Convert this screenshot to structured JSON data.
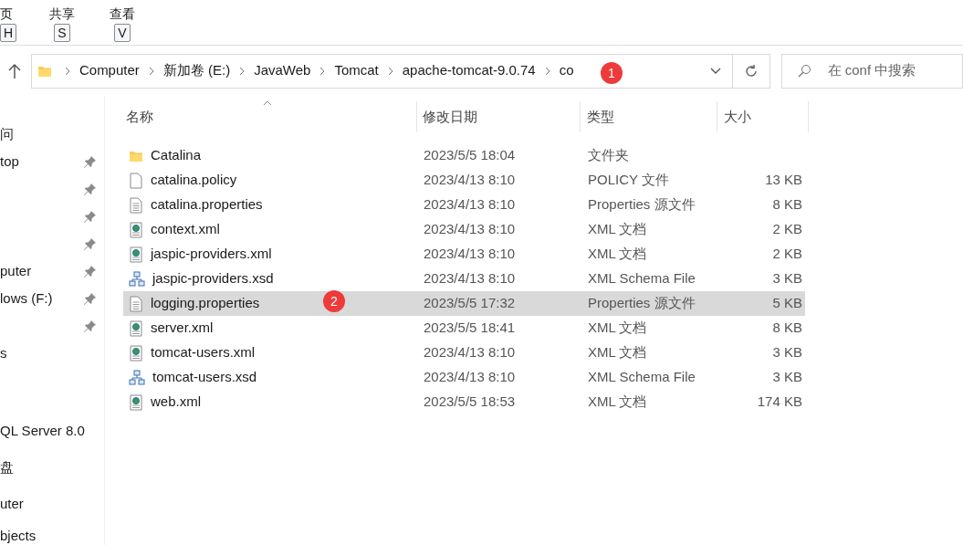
{
  "ribbon": {
    "tabs": [
      {
        "label": "页",
        "key": "H"
      },
      {
        "label": "共享",
        "key": "S"
      },
      {
        "label": "查看",
        "key": "V"
      }
    ]
  },
  "address_bar": {
    "path": [
      "Computer",
      "新加卷 (E:)",
      "JavaWeb",
      "Tomcat",
      "apache-tomcat-9.0.74",
      "co"
    ]
  },
  "search": {
    "placeholder": "在 conf 中搜索"
  },
  "sidebar": {
    "items": [
      {
        "label": "问",
        "pinned": false
      },
      {
        "label": "top",
        "pinned": true
      },
      {
        "pinned": true
      },
      {
        "pinned": true
      },
      {
        "pinned": true
      },
      {
        "label": "puter",
        "pinned": true
      },
      {
        "label": "lows (F:)",
        "pinned": true
      },
      {
        "pinned": true
      },
      {
        "label": "s",
        "pinned": false
      },
      {
        "label": "QL Server 8.0",
        "pinned": false
      },
      {
        "label": "盘",
        "pinned": false
      },
      {
        "label": "uter",
        "pinned": false
      },
      {
        "label": "bjects",
        "pinned": false
      }
    ]
  },
  "table": {
    "columns": [
      "名称",
      "修改日期",
      "类型",
      "大小"
    ],
    "rows": [
      {
        "kind": "folder",
        "name": "Catalina",
        "date": "2023/5/5 18:04",
        "type": "文件夹",
        "size": "",
        "selected": false
      },
      {
        "kind": "file",
        "name": "catalina.policy",
        "date": "2023/4/13 8:10",
        "type": "POLICY 文件",
        "size": "13 KB",
        "selected": false
      },
      {
        "kind": "text",
        "name": "catalina.properties",
        "date": "2023/4/13 8:10",
        "type": "Properties 源文件",
        "size": "8 KB",
        "selected": false
      },
      {
        "kind": "xml",
        "name": "context.xml",
        "date": "2023/4/13 8:10",
        "type": "XML 文档",
        "size": "2 KB",
        "selected": false
      },
      {
        "kind": "xml",
        "name": "jaspic-providers.xml",
        "date": "2023/4/13 8:10",
        "type": "XML 文档",
        "size": "2 KB",
        "selected": false
      },
      {
        "kind": "schema",
        "name": "jaspic-providers.xsd",
        "date": "2023/4/13 8:10",
        "type": "XML Schema File",
        "size": "3 KB",
        "selected": false
      },
      {
        "kind": "text",
        "name": "logging.properties",
        "date": "2023/5/5 17:32",
        "type": "Properties 源文件",
        "size": "5 KB",
        "selected": true
      },
      {
        "kind": "xml",
        "name": "server.xml",
        "date": "2023/5/5 18:41",
        "type": "XML 文档",
        "size": "8 KB",
        "selected": false
      },
      {
        "kind": "xml",
        "name": "tomcat-users.xml",
        "date": "2023/4/13 8:10",
        "type": "XML 文档",
        "size": "3 KB",
        "selected": false
      },
      {
        "kind": "schema",
        "name": "tomcat-users.xsd",
        "date": "2023/4/13 8:10",
        "type": "XML Schema File",
        "size": "3 KB",
        "selected": false
      },
      {
        "kind": "xml",
        "name": "web.xml",
        "date": "2023/5/5 18:53",
        "type": "XML 文档",
        "size": "174 KB",
        "selected": false
      }
    ]
  },
  "annotations": [
    "1",
    "2"
  ]
}
